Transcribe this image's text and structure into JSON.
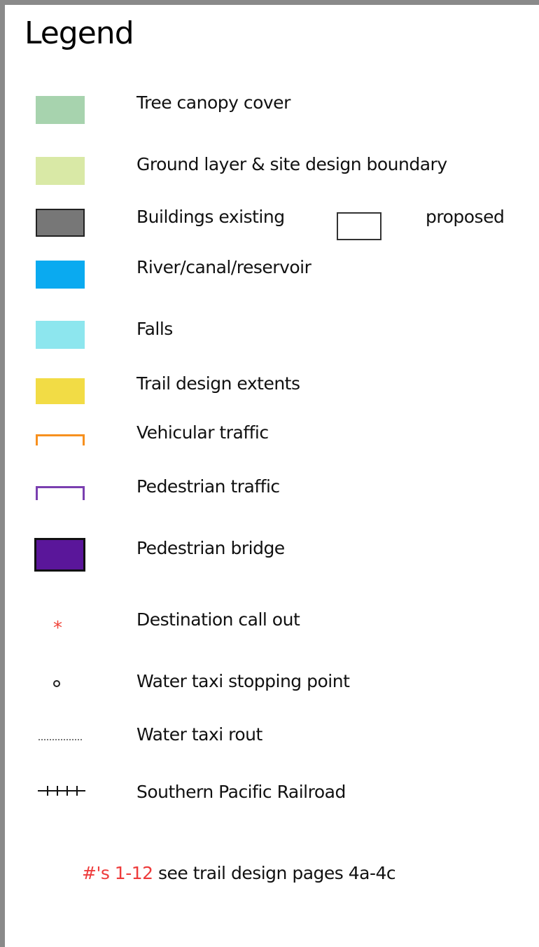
{
  "legend": {
    "title": "Legend",
    "items": [
      {
        "label": "Tree canopy cover",
        "color": "#a7d3ae"
      },
      {
        "label": "Ground layer & site design boundary",
        "color": "#d9e9a6"
      },
      {
        "label": "Buildings existing",
        "color": "#777777",
        "secondary_label": "proposed"
      },
      {
        "label": "River/canal/reservoir",
        "color": "#0aaaf0"
      },
      {
        "label": "Falls",
        "color": "#8de6ee"
      },
      {
        "label": "Trail design extents",
        "color": "#f2dc45"
      },
      {
        "label": "Vehicular traffic",
        "color": "#f7901e",
        "symbol": "bracket"
      },
      {
        "label": "Pedestrian traffic",
        "color": "#7a3fb0",
        "symbol": "bracket"
      },
      {
        "label": "Pedestrian bridge",
        "color": "#5a169a"
      },
      {
        "label": "Destination call out",
        "color": "#f0443a",
        "symbol": "asterisk"
      },
      {
        "label": "Water taxi stopping point",
        "symbol": "circle"
      },
      {
        "label": "Water taxi rout",
        "symbol": "dotted-line"
      },
      {
        "label": "Southern Pacific Railroad",
        "symbol": "railroad"
      }
    ],
    "note": {
      "highlight": "#'s 1-12",
      "text": " see trail design pages 4a-4c"
    }
  }
}
